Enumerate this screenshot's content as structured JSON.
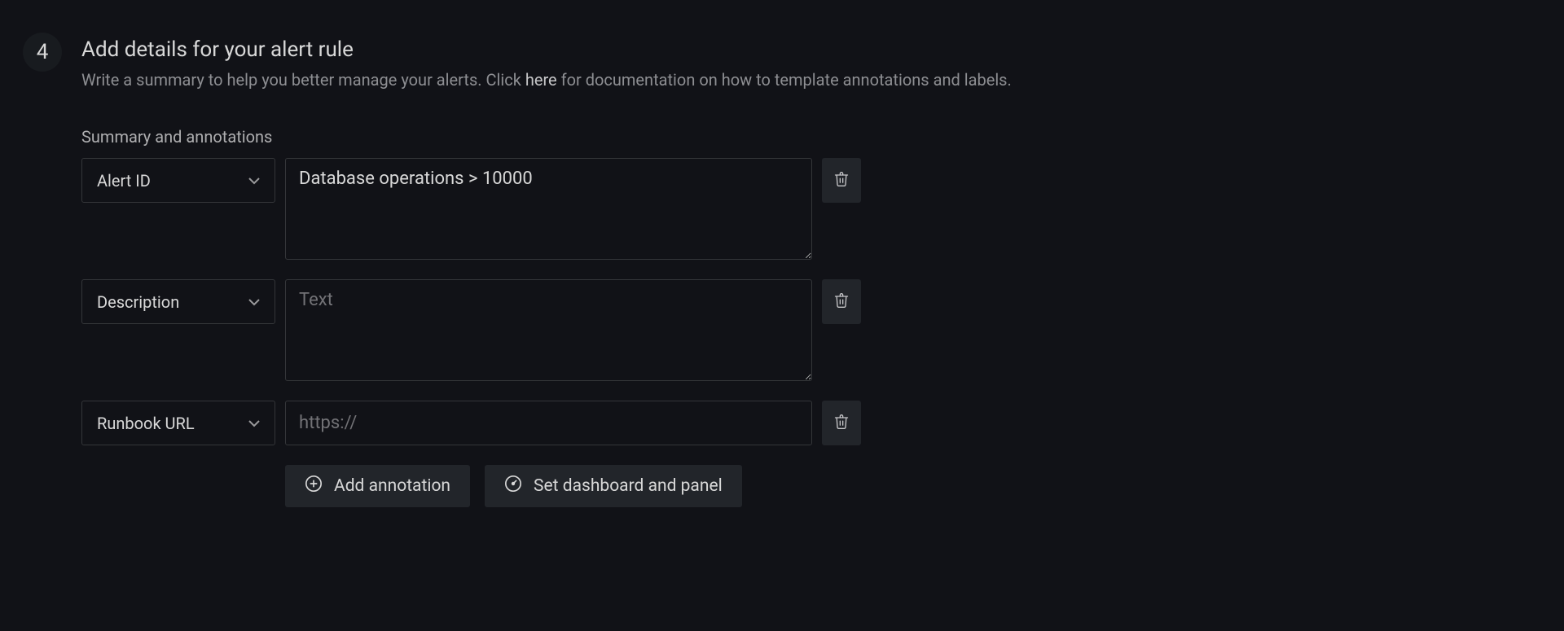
{
  "step": {
    "number": "4",
    "title": "Add details for your alert rule",
    "description_before": "Write a summary to help you better manage your alerts. Click ",
    "description_link": "here",
    "description_after": " for documentation on how to template annotations and labels."
  },
  "section_label": "Summary and annotations",
  "annotations": [
    {
      "key": "Alert ID",
      "value": "Database operations > 10000",
      "placeholder": "",
      "type": "textarea"
    },
    {
      "key": "Description",
      "value": "",
      "placeholder": "Text",
      "type": "textarea"
    },
    {
      "key": "Runbook URL",
      "value": "",
      "placeholder": "https://",
      "type": "input"
    }
  ],
  "buttons": {
    "add_annotation": "Add annotation",
    "set_dashboard": "Set dashboard and panel"
  }
}
